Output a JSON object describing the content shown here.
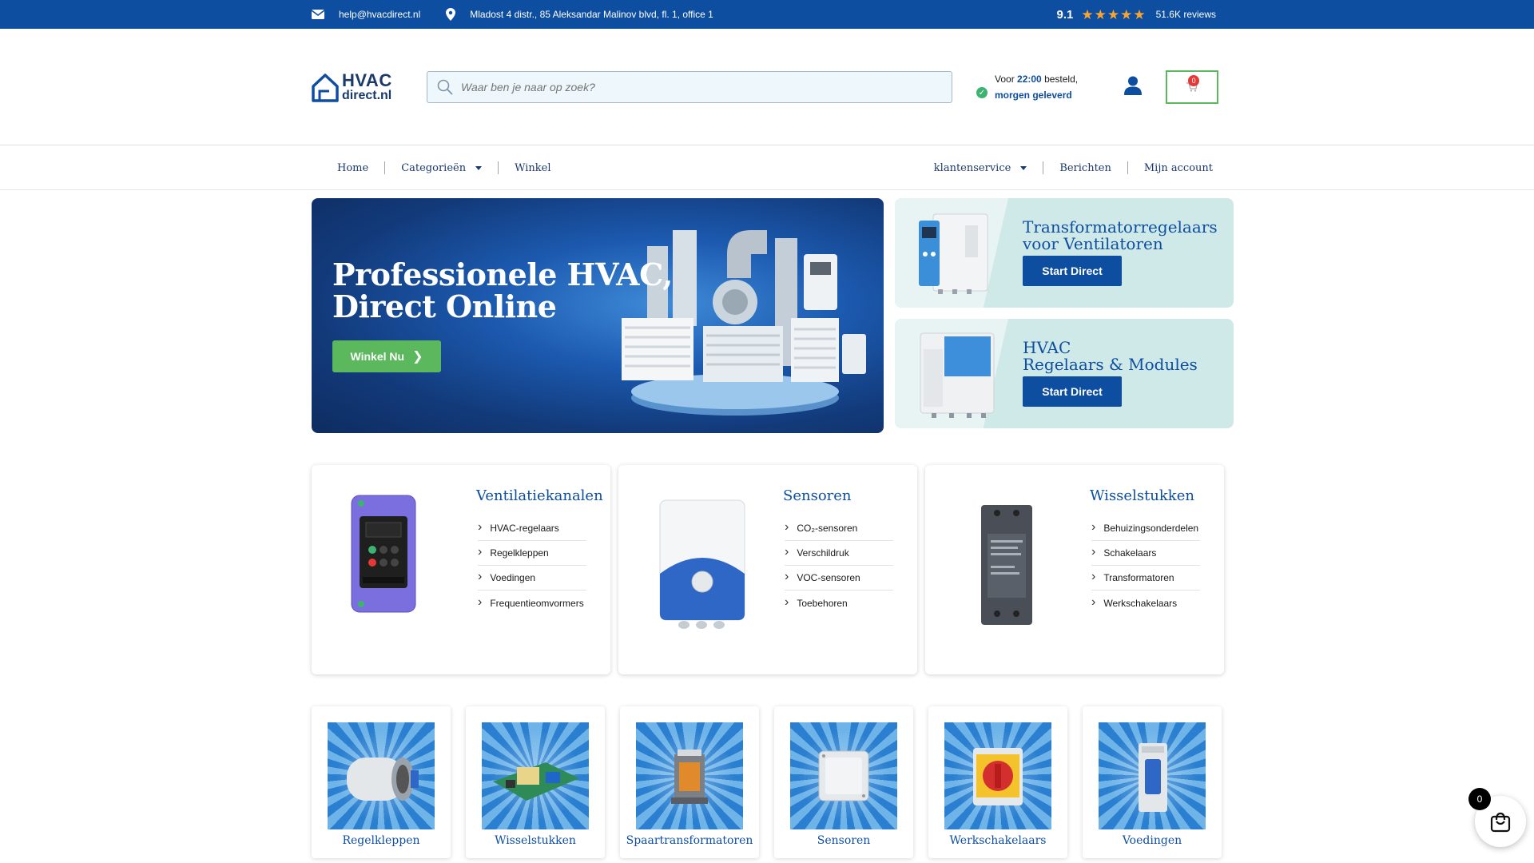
{
  "topbar": {
    "email": "help@hvacdirect.nl",
    "address": "Mladost 4 distr., 85 Aleksandar Malinov blvd, fl. 1, office 1",
    "score": "9.1",
    "reviews": "51.6K reviews"
  },
  "header": {
    "logo_line1": "HVAC",
    "logo_line2": "direct.nl",
    "search_placeholder": "Waar ben je naar op zoek?",
    "delivery_prefix": "Voor ",
    "delivery_time": "22:00",
    "delivery_suffix": " besteld,",
    "delivery_line2": "morgen geleverd",
    "cart_count": "0"
  },
  "nav": {
    "home": "Home",
    "categories": "Categorieën",
    "shop": "Winkel",
    "service": "klantenservice",
    "messages": "Berichten",
    "account": "Mijn account"
  },
  "hero": {
    "title_line1": "Professionele HVAC,",
    "title_line2": "Direct Online",
    "button": "Winkel Nu"
  },
  "promos": [
    {
      "line1": "Transformatorregelaars",
      "line2": "voor Ventilatoren",
      "button": "Start Direct"
    },
    {
      "line1": "HVAC",
      "line2": "Regelaars & Modules",
      "button": "Start Direct"
    }
  ],
  "categories": [
    {
      "title": "Ventilatiekanalen",
      "items": [
        "HVAC-regelaars",
        "Regelkleppen",
        "Voedingen",
        "Frequentieomvormers"
      ]
    },
    {
      "title": "Sensoren",
      "items": [
        "CO₂-sensoren",
        "Verschildruk",
        "VOC-sensoren",
        "Toebehoren"
      ]
    },
    {
      "title": "Wisselstukken",
      "items": [
        "Behuizingsonderdelen",
        "Schakelaars",
        "Transformatoren",
        "Werkschakelaars"
      ]
    }
  ],
  "tiles": [
    "Regelkleppen",
    "Wisselstukken",
    "Spaartransformatoren",
    "Sensoren",
    "Werkschakelaars",
    "Voedingen"
  ],
  "floating_cart_count": "0",
  "colors": {
    "primary": "#0d4ea1",
    "accent": "#5cb85c",
    "star": "#f6a531"
  }
}
